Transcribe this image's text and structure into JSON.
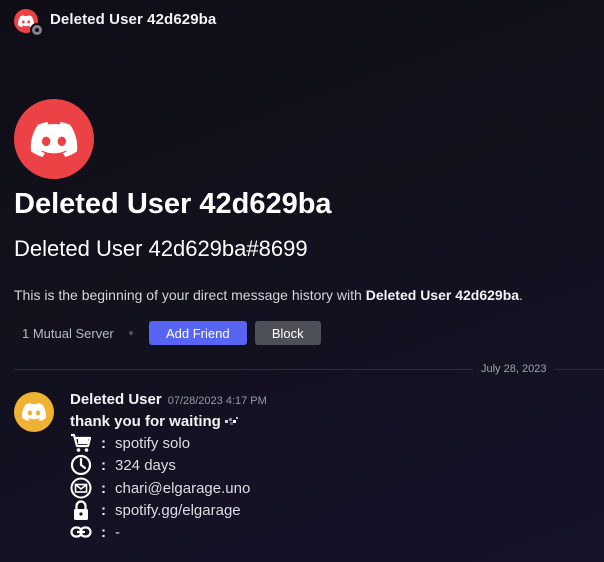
{
  "header": {
    "title": "Deleted User 42d629ba",
    "avatar_color": "#ed4245",
    "status_icon": "offline-status-icon"
  },
  "intro": {
    "display_name": "Deleted User 42d629ba",
    "tag": "Deleted User 42d629ba#8699",
    "description_prefix": "This is the beginning of your direct message history with ",
    "description_name": "Deleted User 42d629ba",
    "description_suffix": ".",
    "mutual_servers": "1 Mutual Server",
    "add_friend_label": "Add Friend",
    "block_label": "Block",
    "accent_color": "#5865f2"
  },
  "divider": {
    "date": "July 28, 2023"
  },
  "message": {
    "author": "Deleted User",
    "timestamp": "07/28/2023 4:17 PM",
    "avatar_color": "#f0b232",
    "first_line": "thank you for waiting",
    "first_line_emoji": "sparkle-icon",
    "lines": [
      {
        "icon": "shopping-cart-icon",
        "text": "spotify solo"
      },
      {
        "icon": "clock-icon",
        "text": "324 days"
      },
      {
        "icon": "mail-icon",
        "text": "chari@elgarage.uno"
      },
      {
        "icon": "lock-icon",
        "text": "spotify.gg/elgarage"
      },
      {
        "icon": "link-icon",
        "text": "-"
      }
    ],
    "separator": ":"
  }
}
